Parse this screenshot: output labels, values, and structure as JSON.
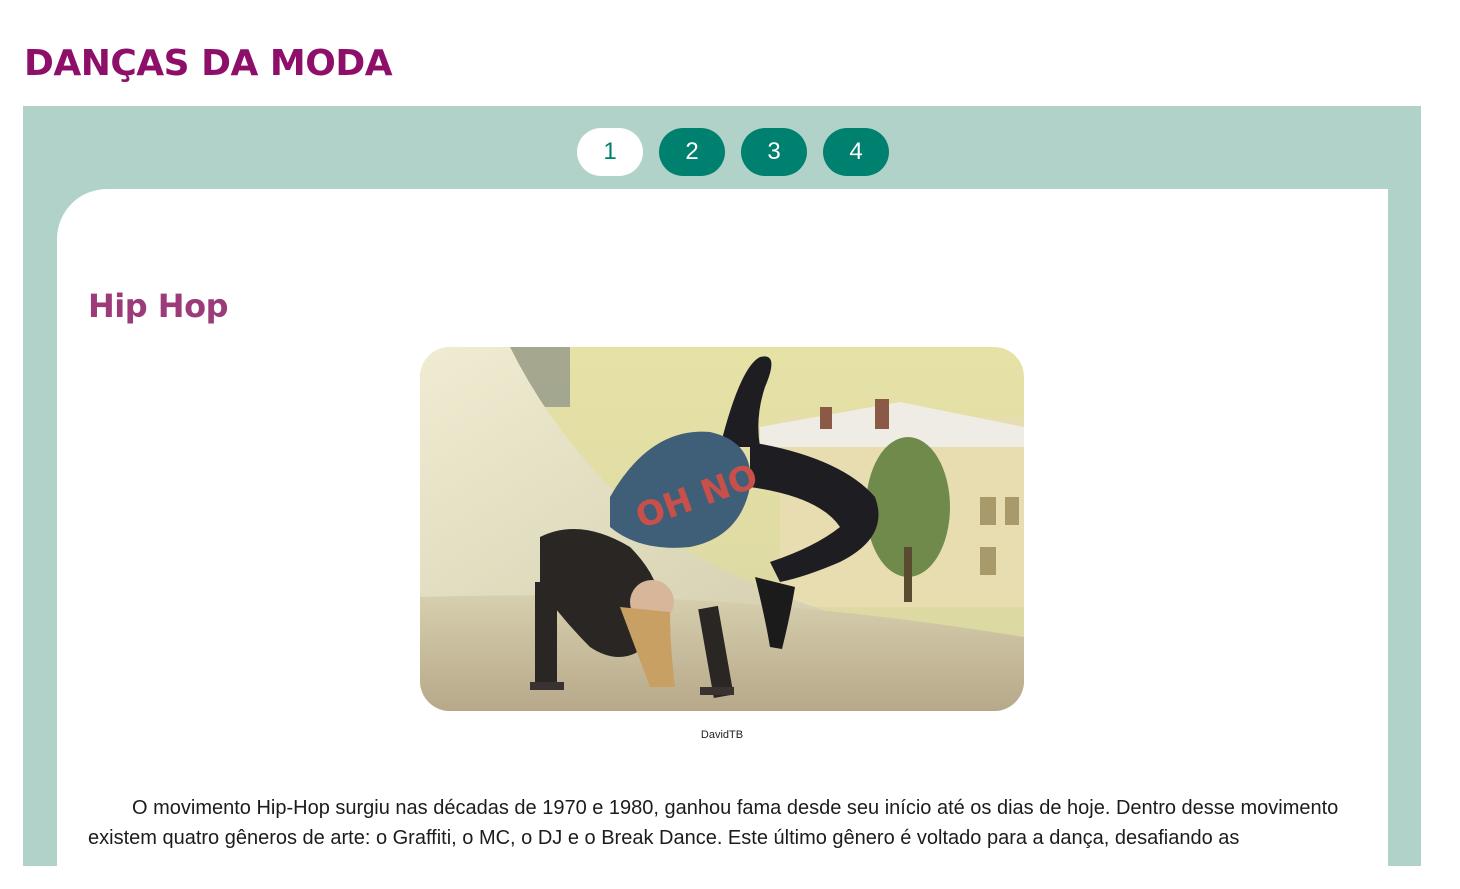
{
  "page": {
    "title": "DANÇAS DA MODA"
  },
  "pager": {
    "items": [
      "1",
      "2",
      "3",
      "4"
    ],
    "active": "1"
  },
  "slide": {
    "title": "Hip Hop",
    "image_credit": "DavidTB",
    "paragraph": "O movimento Hip-Hop surgiu nas décadas de 1970 e 1980, ganhou fama desde seu início até os dias de hoje. Dentro desse movimento existem quatro gêneros de arte: o Graffiti, o MC, o DJ e o Break Dance. Este último gênero é voltado para a dança, desafiando as"
  },
  "colors": {
    "title": "#8e0f6a",
    "slide_title": "#9b3b7a",
    "panel": "#b0d2c9",
    "pager_active_bg": "#ffffff",
    "pager_bg": "#00806e"
  }
}
